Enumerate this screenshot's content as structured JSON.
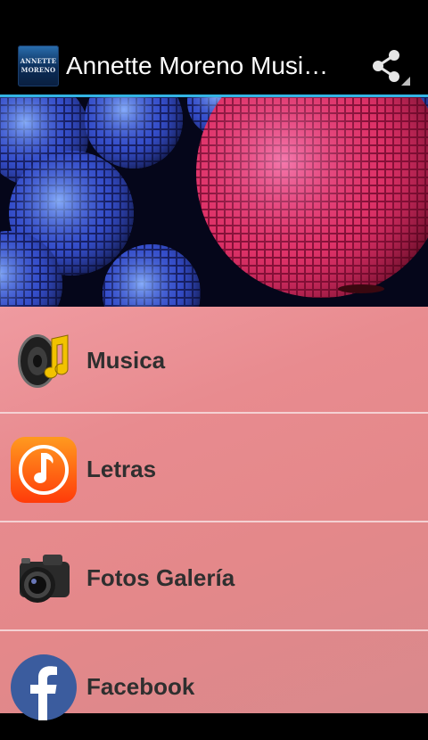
{
  "app": {
    "title": "Annette Moreno Music…",
    "icon_text_line1": "ANNETTE",
    "icon_text_line2": "MORENO"
  },
  "actionbar": {
    "share_icon": "share-icon"
  },
  "menu": {
    "items": [
      {
        "label": "Musica",
        "icon": "speaker-music-icon"
      },
      {
        "label": "Letras",
        "icon": "music-note-icon"
      },
      {
        "label": "Fotos Galería",
        "icon": "camera-icon"
      },
      {
        "label": "Facebook",
        "icon": "facebook-icon"
      }
    ]
  },
  "colors": {
    "actionbar_bg": "#000000",
    "accent_line": "#33b5e5",
    "menu_bg": "#e88b8f",
    "label_text": "#2f2f2f"
  }
}
